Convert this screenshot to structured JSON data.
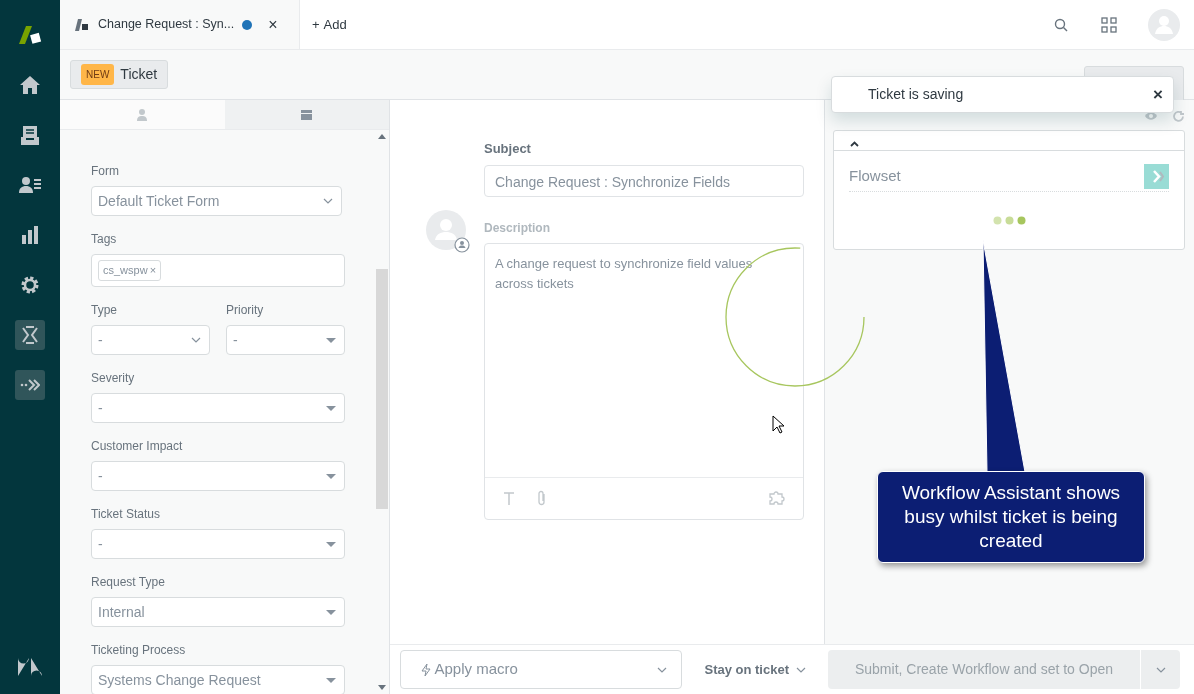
{
  "top_tab": {
    "title": "Change Request : Syn...",
    "unsaved": true,
    "close": "×"
  },
  "add_tab": {
    "plus": "+",
    "label": "Add"
  },
  "ticket_badge": {
    "badge": "NEW",
    "label": "Ticket"
  },
  "panel_tabs": [
    {
      "kind": "user",
      "selected": false
    },
    {
      "kind": "card",
      "selected": true
    }
  ],
  "fields": [
    {
      "kind": "combo",
      "label": "Form",
      "value": "Default Ticket Form",
      "narrow": true
    },
    {
      "kind": "tags",
      "label": "Tags",
      "tags": [
        {
          "text": "cs_wspw",
          "remove": "×"
        }
      ]
    },
    {
      "kind": "pair",
      "items": [
        {
          "kind": "combo",
          "label": "Type",
          "value": "-"
        },
        {
          "kind": "select",
          "label": "Priority",
          "value": "-"
        }
      ]
    },
    {
      "kind": "select",
      "label": "Severity",
      "value": "-"
    },
    {
      "kind": "select",
      "label": "Customer Impact",
      "value": "-"
    },
    {
      "kind": "select",
      "label": "Ticket Status",
      "value": "-"
    },
    {
      "kind": "select",
      "label": "Request Type",
      "value": "Internal"
    },
    {
      "kind": "select",
      "label": "Ticketing Process",
      "value": "Systems Change Request"
    }
  ],
  "subject": {
    "label": "Subject",
    "value": "Change Request : Synchronize Fields"
  },
  "description": {
    "label": "Description",
    "value": "A change request to synchronize field values across tickets"
  },
  "toast": {
    "text": "Ticket is saving",
    "close": "×"
  },
  "app_card": {
    "title": "Flowset",
    "busy": true
  },
  "footer": {
    "macro": "Apply macro",
    "stay": "Stay on ticket",
    "submit": "Submit, Create Workflow and set to Open",
    "submit_disabled": true
  },
  "callout": {
    "text": "Workflow Assistant shows busy whilst ticket is being created"
  }
}
